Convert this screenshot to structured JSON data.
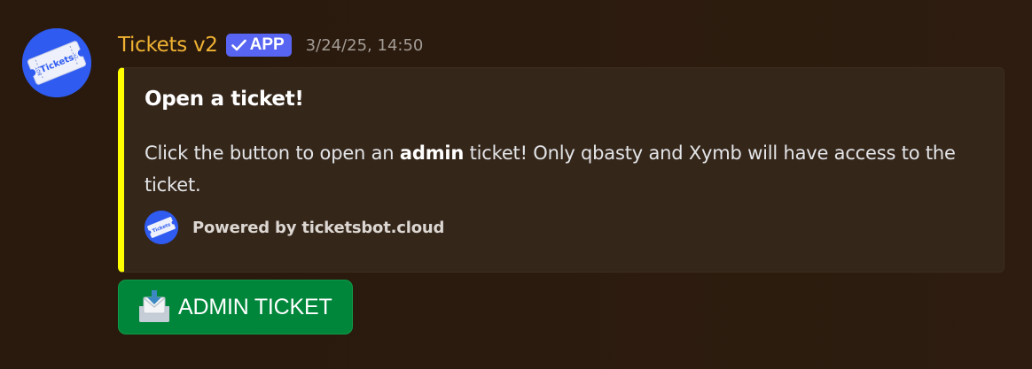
{
  "message": {
    "author": {
      "name": "Tickets v2",
      "avatar_icon": "tickets-logo-icon",
      "name_color": "#f0b232"
    },
    "badge": {
      "label": "APP",
      "icon": "checkmark-icon",
      "color": "#5865f2"
    },
    "timestamp": "3/24/25, 14:50"
  },
  "embed": {
    "accent_color": "#ffff00",
    "title": "Open a ticket!",
    "description": {
      "before": "Click the button to open an ",
      "bold": "admin",
      "after": " ticket! Only qbasty and Xymb will have access to the ticket."
    },
    "footer": {
      "icon": "tickets-logo-icon",
      "text": "Powered by ticketsbot.cloud"
    }
  },
  "button": {
    "label": "ADMIN TICKET",
    "icon": "inbox-tray-envelope-icon",
    "color": "#00863a"
  }
}
